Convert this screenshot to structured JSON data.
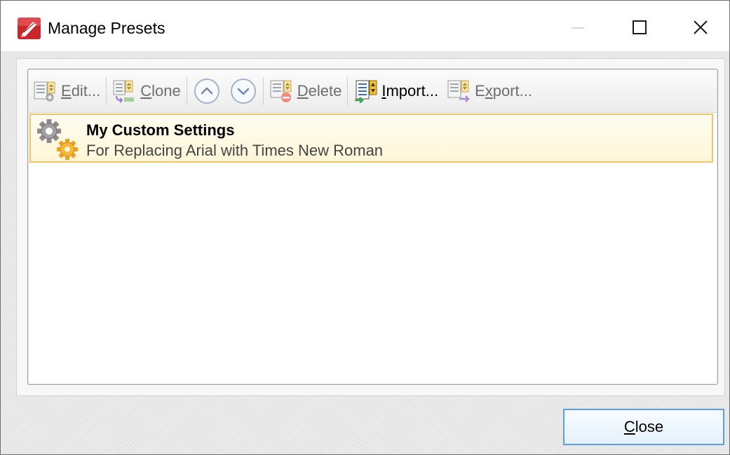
{
  "window": {
    "title": "Manage Presets",
    "minimize_icon": "minimize-icon",
    "maximize_icon": "maximize-icon",
    "close_icon": "close-icon"
  },
  "toolbar": {
    "edit": {
      "pre": "",
      "mnemonic": "E",
      "post": "dit...",
      "icon": "edit-preset-icon",
      "enabled": false
    },
    "clone": {
      "pre": "",
      "mnemonic": "C",
      "post": "lone",
      "icon": "clone-preset-icon",
      "enabled": false
    },
    "move_up": {
      "icon": "chevron-up-icon",
      "enabled": false
    },
    "move_down": {
      "icon": "chevron-down-icon",
      "enabled": false
    },
    "delete": {
      "pre": "",
      "mnemonic": "D",
      "post": "elete",
      "icon": "delete-preset-icon",
      "enabled": false
    },
    "import": {
      "pre": "",
      "mnemonic": "I",
      "post": "mport...",
      "icon": "import-preset-icon",
      "enabled": true
    },
    "export": {
      "pre": "E",
      "mnemonic": "x",
      "post": "port...",
      "icon": "export-preset-icon",
      "enabled": false
    }
  },
  "presets": [
    {
      "title": "My Custom Settings",
      "description": "For Replacing Arial with Times New Roman",
      "icon": "gears-icon",
      "selected": true
    }
  ],
  "footer": {
    "close_pre": "",
    "close_mnemonic": "C",
    "close_post": "lose"
  },
  "colors": {
    "selection_border": "#f0c56a",
    "selection_fill": "#fff6d8",
    "focus_border": "#5aa0e0",
    "brand_red": "#c8262c"
  }
}
